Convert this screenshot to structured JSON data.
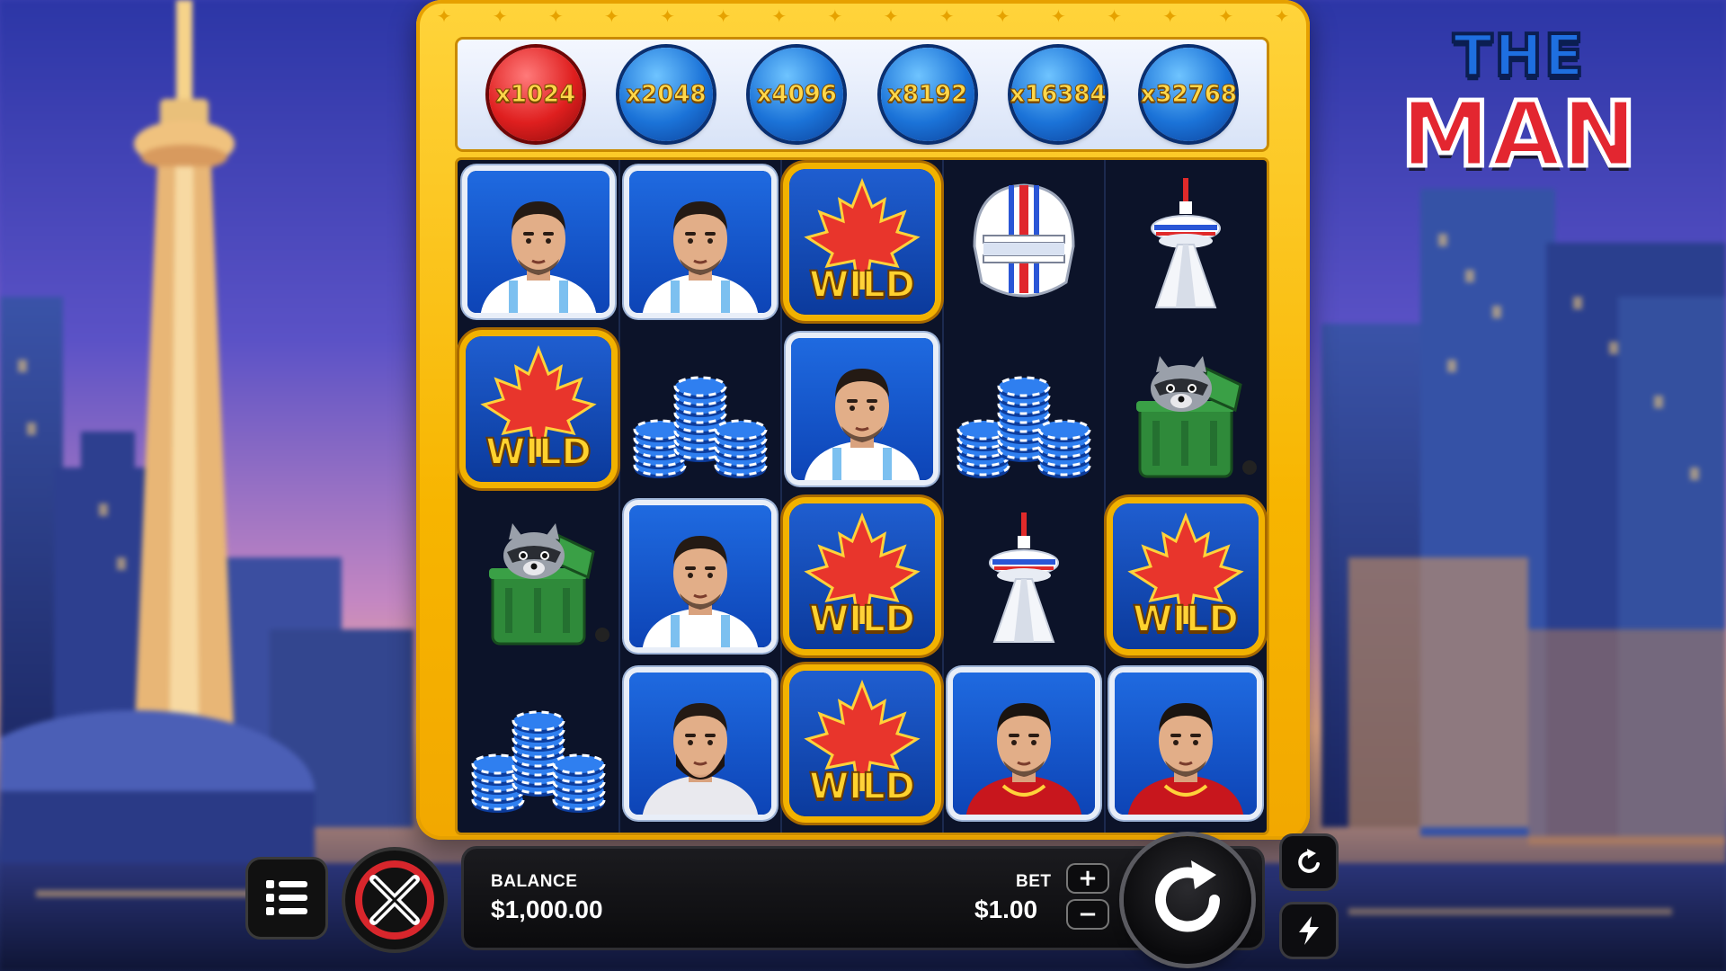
{
  "logo": {
    "line1": "THE",
    "line2": "MAN"
  },
  "multipliers": [
    {
      "label": "x1024",
      "active": true
    },
    {
      "label": "x2048",
      "active": false
    },
    {
      "label": "x4096",
      "active": false
    },
    {
      "label": "x8192",
      "active": false
    },
    {
      "label": "x16384",
      "active": false
    },
    {
      "label": "x32768",
      "active": false
    }
  ],
  "grid": {
    "rows": [
      [
        "man-a",
        "man-a",
        "wild",
        "helmet",
        "cn-tower"
      ],
      [
        "wild",
        "chips",
        "man-a",
        "chips",
        "raccoon"
      ],
      [
        "raccoon",
        "man-a",
        "wild",
        "cn-tower",
        "wild"
      ],
      [
        "chips",
        "man-b",
        "wild",
        "man-c",
        "man-c"
      ]
    ],
    "wild_label": "WILD"
  },
  "bottom_bar": {
    "balance_label": "BALANCE",
    "balance_value": "$1,000.00",
    "bet_label": "BET",
    "bet_value": "$1.00",
    "bet_plus": "+",
    "bet_minus": "−"
  },
  "colors": {
    "frame_gold": "#f7b500",
    "multiplier_blue": "#1b73d8",
    "multiplier_active_red": "#df1f1f",
    "wild_gold": "#ffd22e"
  }
}
